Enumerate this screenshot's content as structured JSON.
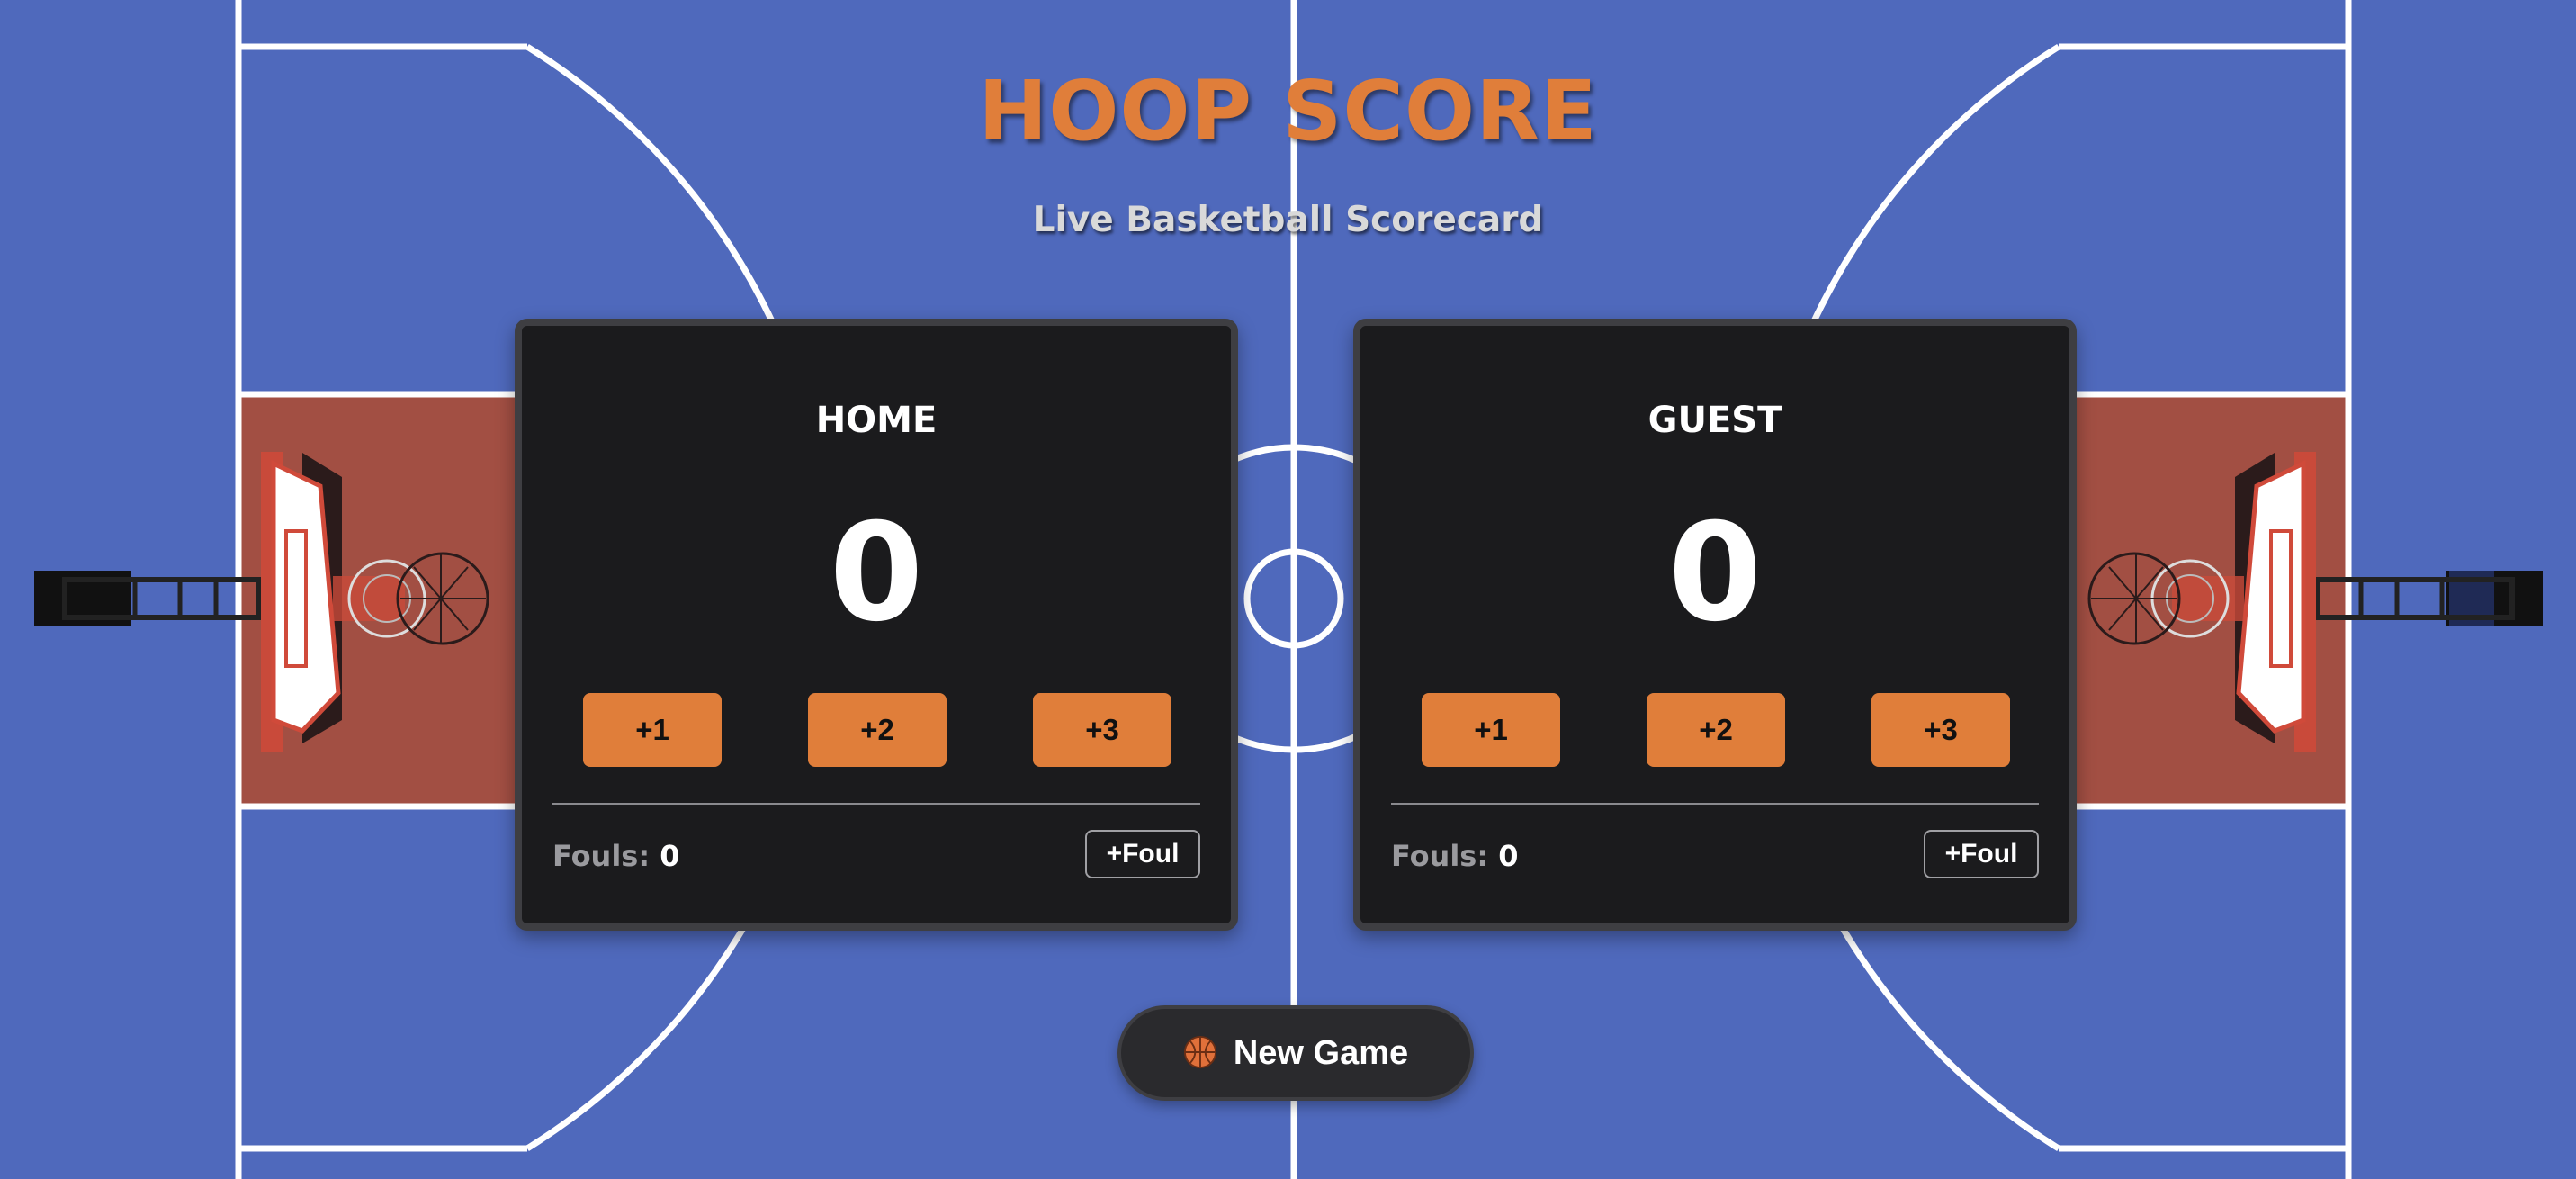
{
  "header": {
    "title": "HOOP SCORE",
    "subtitle": "Live Basketball Scorecard"
  },
  "teams": [
    {
      "name": "HOME",
      "score": "0",
      "buttons": [
        "+1",
        "+2",
        "+3"
      ],
      "fouls_label": "Fouls:",
      "fouls_value": "0",
      "foul_button": "+Foul"
    },
    {
      "name": "GUEST",
      "score": "0",
      "buttons": [
        "+1",
        "+2",
        "+3"
      ],
      "fouls_label": "Fouls:",
      "fouls_value": "0",
      "foul_button": "+Foul"
    }
  ],
  "actions": {
    "new_game_label": "New Game",
    "new_game_icon": "basketball-icon"
  },
  "colors": {
    "court": "#4F69BC",
    "paint": "#A24F43",
    "accent": "#E07E3A",
    "card": "#1B1B1D",
    "card_border": "#3E3E42"
  }
}
